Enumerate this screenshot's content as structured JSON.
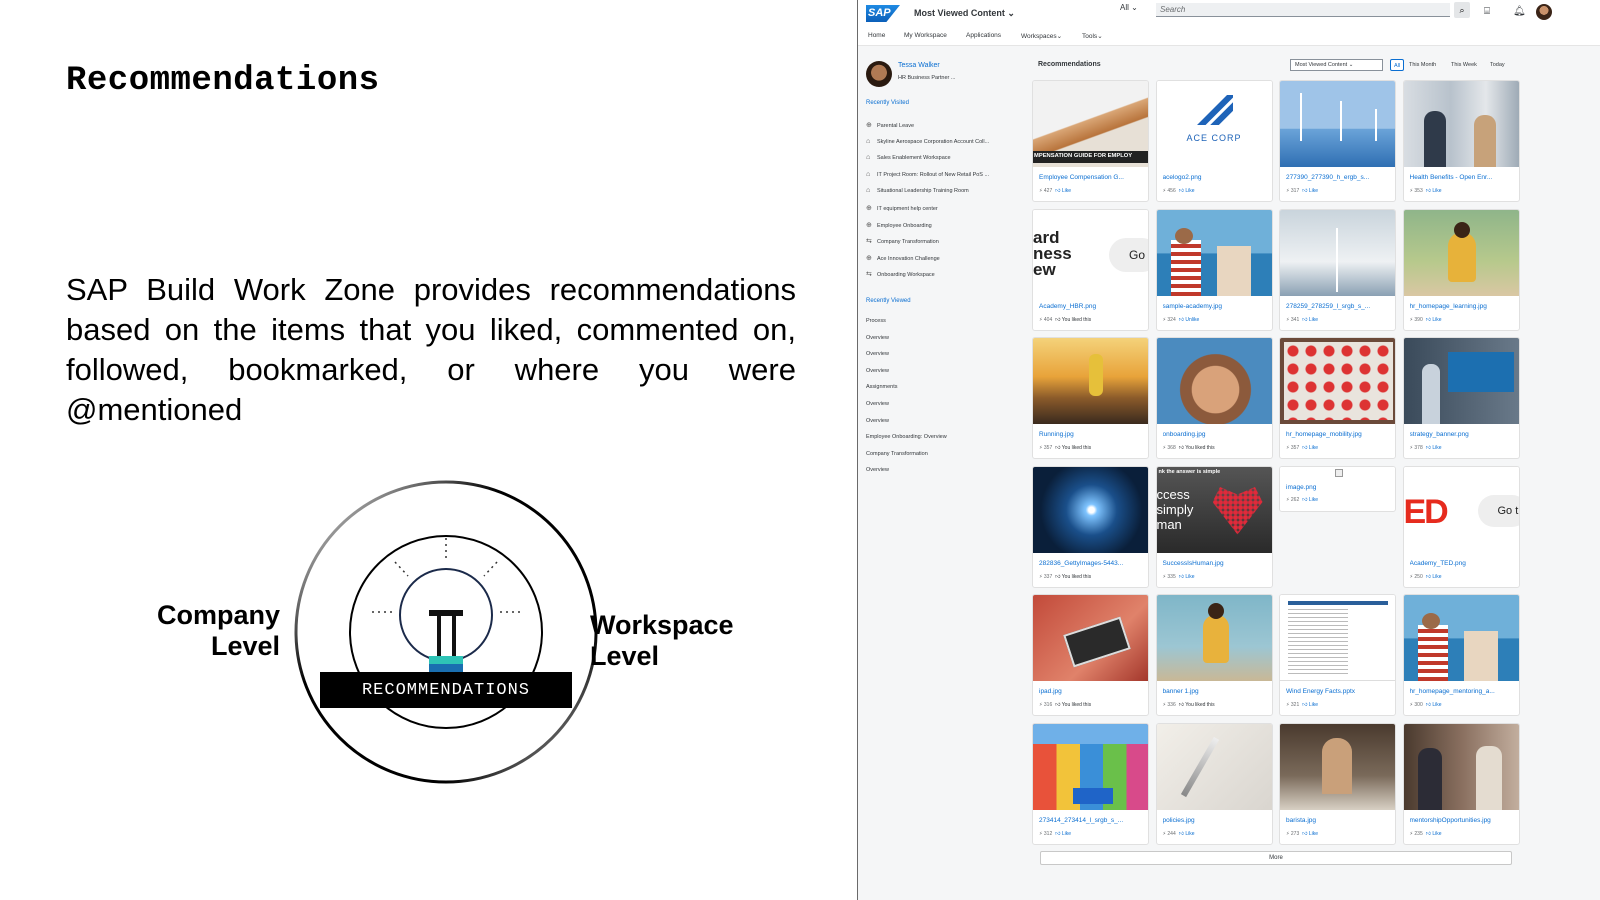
{
  "slide": {
    "title": "Recommendations",
    "body": "SAP Build Work Zone provides recommendations based on the items that you liked, commented on, followed, bookmarked, or where you were @mentioned",
    "diagram": {
      "left_label_1": "Company",
      "left_label_2": "Level",
      "right_label_1": "Workspace",
      "right_label_2": "Level",
      "center_label": "RECOMMENDATIONS"
    }
  },
  "app": {
    "logo_text": "SAP",
    "title": "Most Viewed Content",
    "search": {
      "scope": "All",
      "placeholder": "Search"
    },
    "nav": [
      "Home",
      "My Workspace",
      "Applications",
      "Workspaces",
      "Tools"
    ],
    "profile": {
      "name": "Tessa Walker",
      "role": "HR Business Partner ..."
    },
    "recently_visited_heading": "Recently Visited",
    "recently_visited": [
      {
        "icon": "globe-icon",
        "label": "Parental Leave"
      },
      {
        "icon": "lock-icon",
        "label": "Skyline Aerospace Corporation Account Coll..."
      },
      {
        "icon": "lock-icon",
        "label": "Sales Enablement Workspace"
      },
      {
        "icon": "lock-icon",
        "label": "IT Project Room: Rollout of New Retail PoS ..."
      },
      {
        "icon": "lock-icon",
        "label": "Situational Leadership Training Room"
      },
      {
        "icon": "globe-icon",
        "label": "IT equipment help center"
      },
      {
        "icon": "globe-icon",
        "label": "Employee Onboarding"
      },
      {
        "icon": "link-icon",
        "label": "Company Transformation"
      },
      {
        "icon": "globe-icon",
        "label": "Ace Innovation Challenge"
      },
      {
        "icon": "link-icon",
        "label": "Onboarding Workspace"
      }
    ],
    "recently_viewed_heading": "Recently Viewed",
    "recently_viewed": [
      "Process",
      "Overview",
      "Overview",
      "Overview",
      "Assignments",
      "Overview",
      "Overview",
      "Employee Onboarding: Overview",
      "Company Transformation",
      "Overview"
    ],
    "recommendations_heading": "Recommendations",
    "sort_value": "Most Viewed Content",
    "time_filters": [
      "All",
      "This Month",
      "This Week",
      "Today"
    ],
    "active_filter": "All",
    "cards": [
      {
        "name": "Employee Compensation G...",
        "count": "427",
        "action": "Like",
        "thumb": "compensation"
      },
      {
        "name": "acelogo2.png",
        "count": "456",
        "action": "Like",
        "thumb": "acecorp"
      },
      {
        "name": "277390_277390_h_ergb_s...",
        "count": "317",
        "action": "Like",
        "thumb": "turbines"
      },
      {
        "name": "Health Benefits - Open Enr...",
        "count": "353",
        "action": "Like",
        "thumb": "meeting"
      },
      {
        "name": "Academy_HBR.png",
        "count": "404",
        "action": "You liked this",
        "thumb": "hbr"
      },
      {
        "name": "sample-academy.jpg",
        "count": "324",
        "action": "Unlike",
        "thumb": "sailing"
      },
      {
        "name": "278259_278259_l_srgb_s_...",
        "count": "341",
        "action": "Like",
        "thumb": "windsky"
      },
      {
        "name": "hr_homepage_learning.jpg",
        "count": "390",
        "action": "Like",
        "thumb": "laptopgirl"
      },
      {
        "name": "Running.jpg",
        "count": "357",
        "action": "You liked this",
        "thumb": "running"
      },
      {
        "name": "onboarding.jpg",
        "count": "368",
        "action": "You liked this",
        "thumb": "hands"
      },
      {
        "name": "hr_homepage_mobility.jpg",
        "count": "357",
        "action": "Like",
        "thumb": "umbrellas"
      },
      {
        "name": "strategy_banner.png",
        "count": "378",
        "action": "Like",
        "thumb": "presentation"
      },
      {
        "name": "282836_GettyImages-5443...",
        "count": "337",
        "action": "You liked this",
        "thumb": "tunnel"
      },
      {
        "name": "SuccessIsHuman.jpg",
        "count": "335",
        "action": "Like",
        "thumb": "heart"
      },
      {
        "name": "image.png",
        "count": "262",
        "action": "Like",
        "thumb": "broken"
      },
      {
        "name": "Academy_TED.png",
        "count": "250",
        "action": "Like",
        "thumb": "ted"
      },
      {
        "name": "ipad.jpg",
        "count": "316",
        "action": "You liked this",
        "thumb": "ipad"
      },
      {
        "name": "banner 1.jpg",
        "count": "336",
        "action": "You liked this",
        "thumb": "wallgirl"
      },
      {
        "name": "Wind Energy Facts.pptx",
        "count": "321",
        "action": "Like",
        "thumb": "doc"
      },
      {
        "name": "hr_homepage_mentoring_a...",
        "count": "300",
        "action": "Like",
        "thumb": "sailing"
      },
      {
        "name": "273414_273414_l_srgb_s_...",
        "count": "312",
        "action": "Like",
        "thumb": "colorful"
      },
      {
        "name": "policies.jpg",
        "count": "244",
        "action": "Like",
        "thumb": "pen"
      },
      {
        "name": "barista.jpg",
        "count": "273",
        "action": "Like",
        "thumb": "barista"
      },
      {
        "name": "mentorshipOpportunities.jpg",
        "count": "235",
        "action": "Like",
        "thumb": "cafe"
      }
    ],
    "thumb_texts": {
      "compensation": "MPENSATION GUIDE FOR EMPLOY",
      "acecorp": "ACE CORP",
      "hbr_1": "ard",
      "hbr_2": "ness",
      "hbr_3": "ew",
      "hbr_go": "Go",
      "heart_top": "nk the answer is simple",
      "heart_1": "ccess",
      "heart_2": "simply",
      "heart_3": "man",
      "ted": "ED",
      "ted_go": "Go t"
    },
    "more_label": "More"
  }
}
